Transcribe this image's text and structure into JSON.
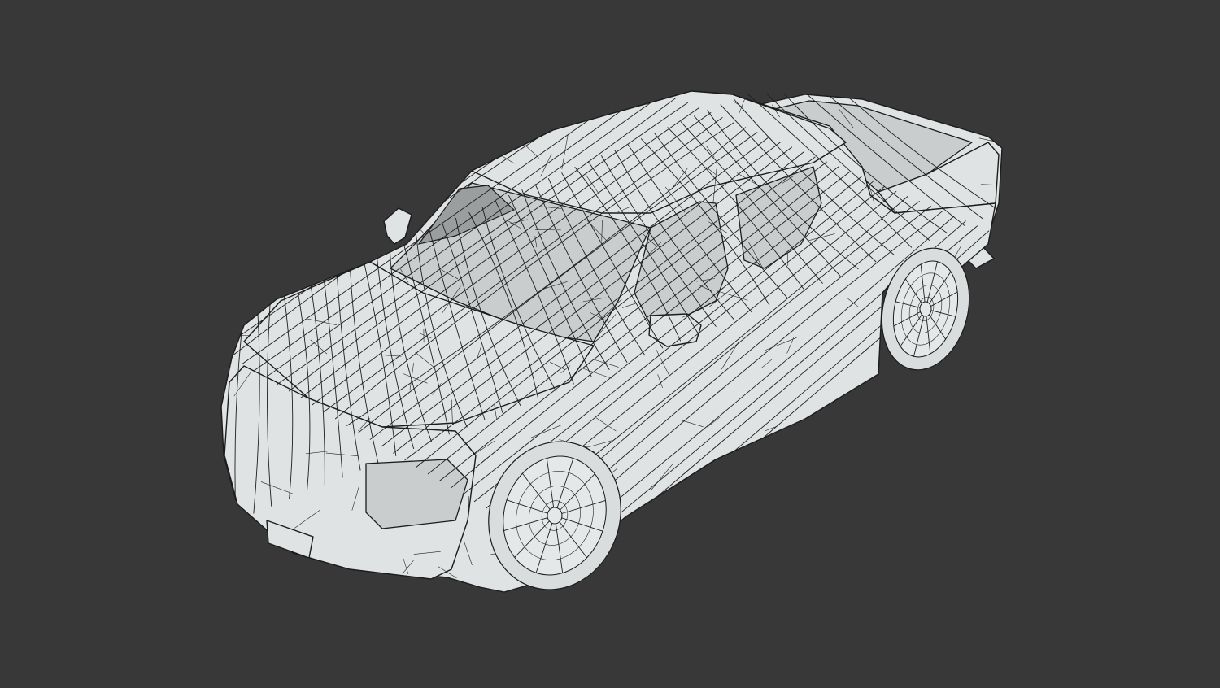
{
  "scene": {
    "background_color": "#383838",
    "model_color": "#dfe3e3",
    "wire_color": "#1c1c1c",
    "glass_color": "#9a9e9f",
    "render_mode": "wireframe-shaded",
    "subject": "pickup-truck"
  }
}
